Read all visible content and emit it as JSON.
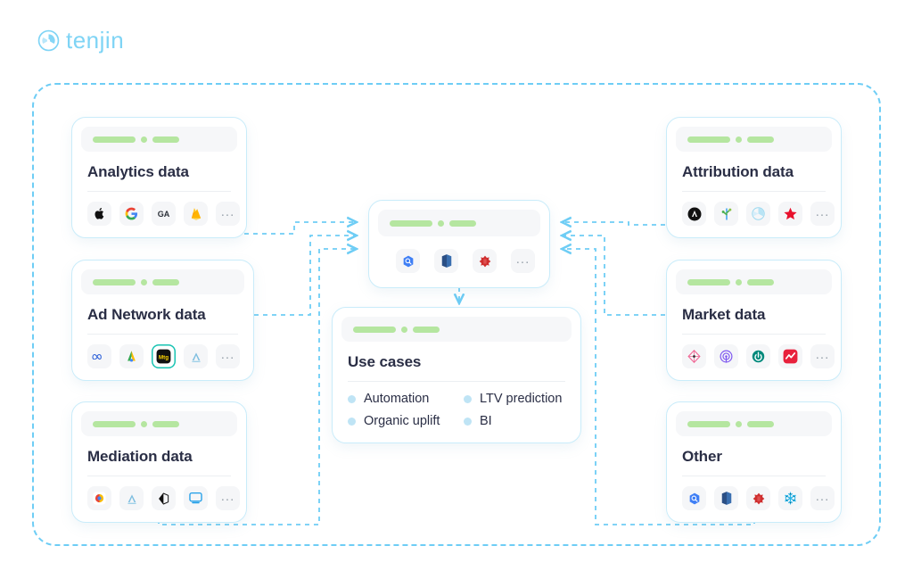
{
  "brand": {
    "name": "tenjin",
    "logo_icon": "tenjin-circle-icon",
    "color": "#7fd4f5"
  },
  "colors": {
    "accent": "#6ecdf5",
    "card_border": "#c9ecfa",
    "title": "#2a2e45",
    "skeleton_green": "#b5e6a0",
    "bullet": "#bfe4f5"
  },
  "cards": {
    "analytics": {
      "title": "Analytics data",
      "icons": [
        {
          "name": "apple-icon",
          "label": "Apple"
        },
        {
          "name": "google-icon",
          "label": "Google"
        },
        {
          "name": "google-analytics-icon",
          "label": "GA"
        },
        {
          "name": "firebase-icon",
          "label": "Firebase"
        }
      ],
      "more_label": "..."
    },
    "ad_network": {
      "title": "Ad Network data",
      "icons": [
        {
          "name": "meta-icon",
          "label": "Meta"
        },
        {
          "name": "google-ads-icon",
          "label": "Google Ads"
        },
        {
          "name": "mintegral-icon",
          "label": "Mintegral"
        },
        {
          "name": "applovin-icon",
          "label": "AppLovin"
        }
      ],
      "more_label": "..."
    },
    "mediation": {
      "title": "Mediation data",
      "icons": [
        {
          "name": "admob-icon",
          "label": "AdMob"
        },
        {
          "name": "applovin-max-icon",
          "label": "AppLovin MAX"
        },
        {
          "name": "unity-icon",
          "label": "Unity"
        },
        {
          "name": "ironsource-icon",
          "label": "ironSource"
        }
      ],
      "more_label": "..."
    },
    "attribution": {
      "title": "Attribution data",
      "icons": [
        {
          "name": "appsflyer-icon",
          "label": "AppsFlyer"
        },
        {
          "name": "branch-icon",
          "label": "Branch"
        },
        {
          "name": "tenjin-icon",
          "label": "Tenjin"
        },
        {
          "name": "adjust-icon",
          "label": "Adjust"
        }
      ],
      "more_label": "..."
    },
    "market": {
      "title": "Market data",
      "icons": [
        {
          "name": "sensor-tower-icon",
          "label": "Sensor Tower"
        },
        {
          "name": "appmagic-icon",
          "label": "AppMagic"
        },
        {
          "name": "data-ai-icon",
          "label": "data.ai"
        },
        {
          "name": "appfigures-icon",
          "label": "Appfigures"
        }
      ],
      "more_label": "..."
    },
    "other": {
      "title": "Other",
      "icons": [
        {
          "name": "bigquery-icon",
          "label": "BigQuery"
        },
        {
          "name": "redshift-icon",
          "label": "Redshift"
        },
        {
          "name": "aws-icon",
          "label": "AWS"
        },
        {
          "name": "snowflake-icon",
          "label": "Snowflake"
        }
      ],
      "more_label": "..."
    },
    "center": {
      "title": "",
      "icons": [
        {
          "name": "bigquery-icon",
          "label": "BigQuery"
        },
        {
          "name": "redshift-icon",
          "label": "Redshift"
        },
        {
          "name": "aws-icon",
          "label": "AWS"
        }
      ],
      "more_label": "..."
    },
    "use_cases": {
      "title": "Use cases",
      "items": [
        "Automation",
        "LTV prediction",
        "Organic uplift",
        "BI"
      ]
    }
  }
}
